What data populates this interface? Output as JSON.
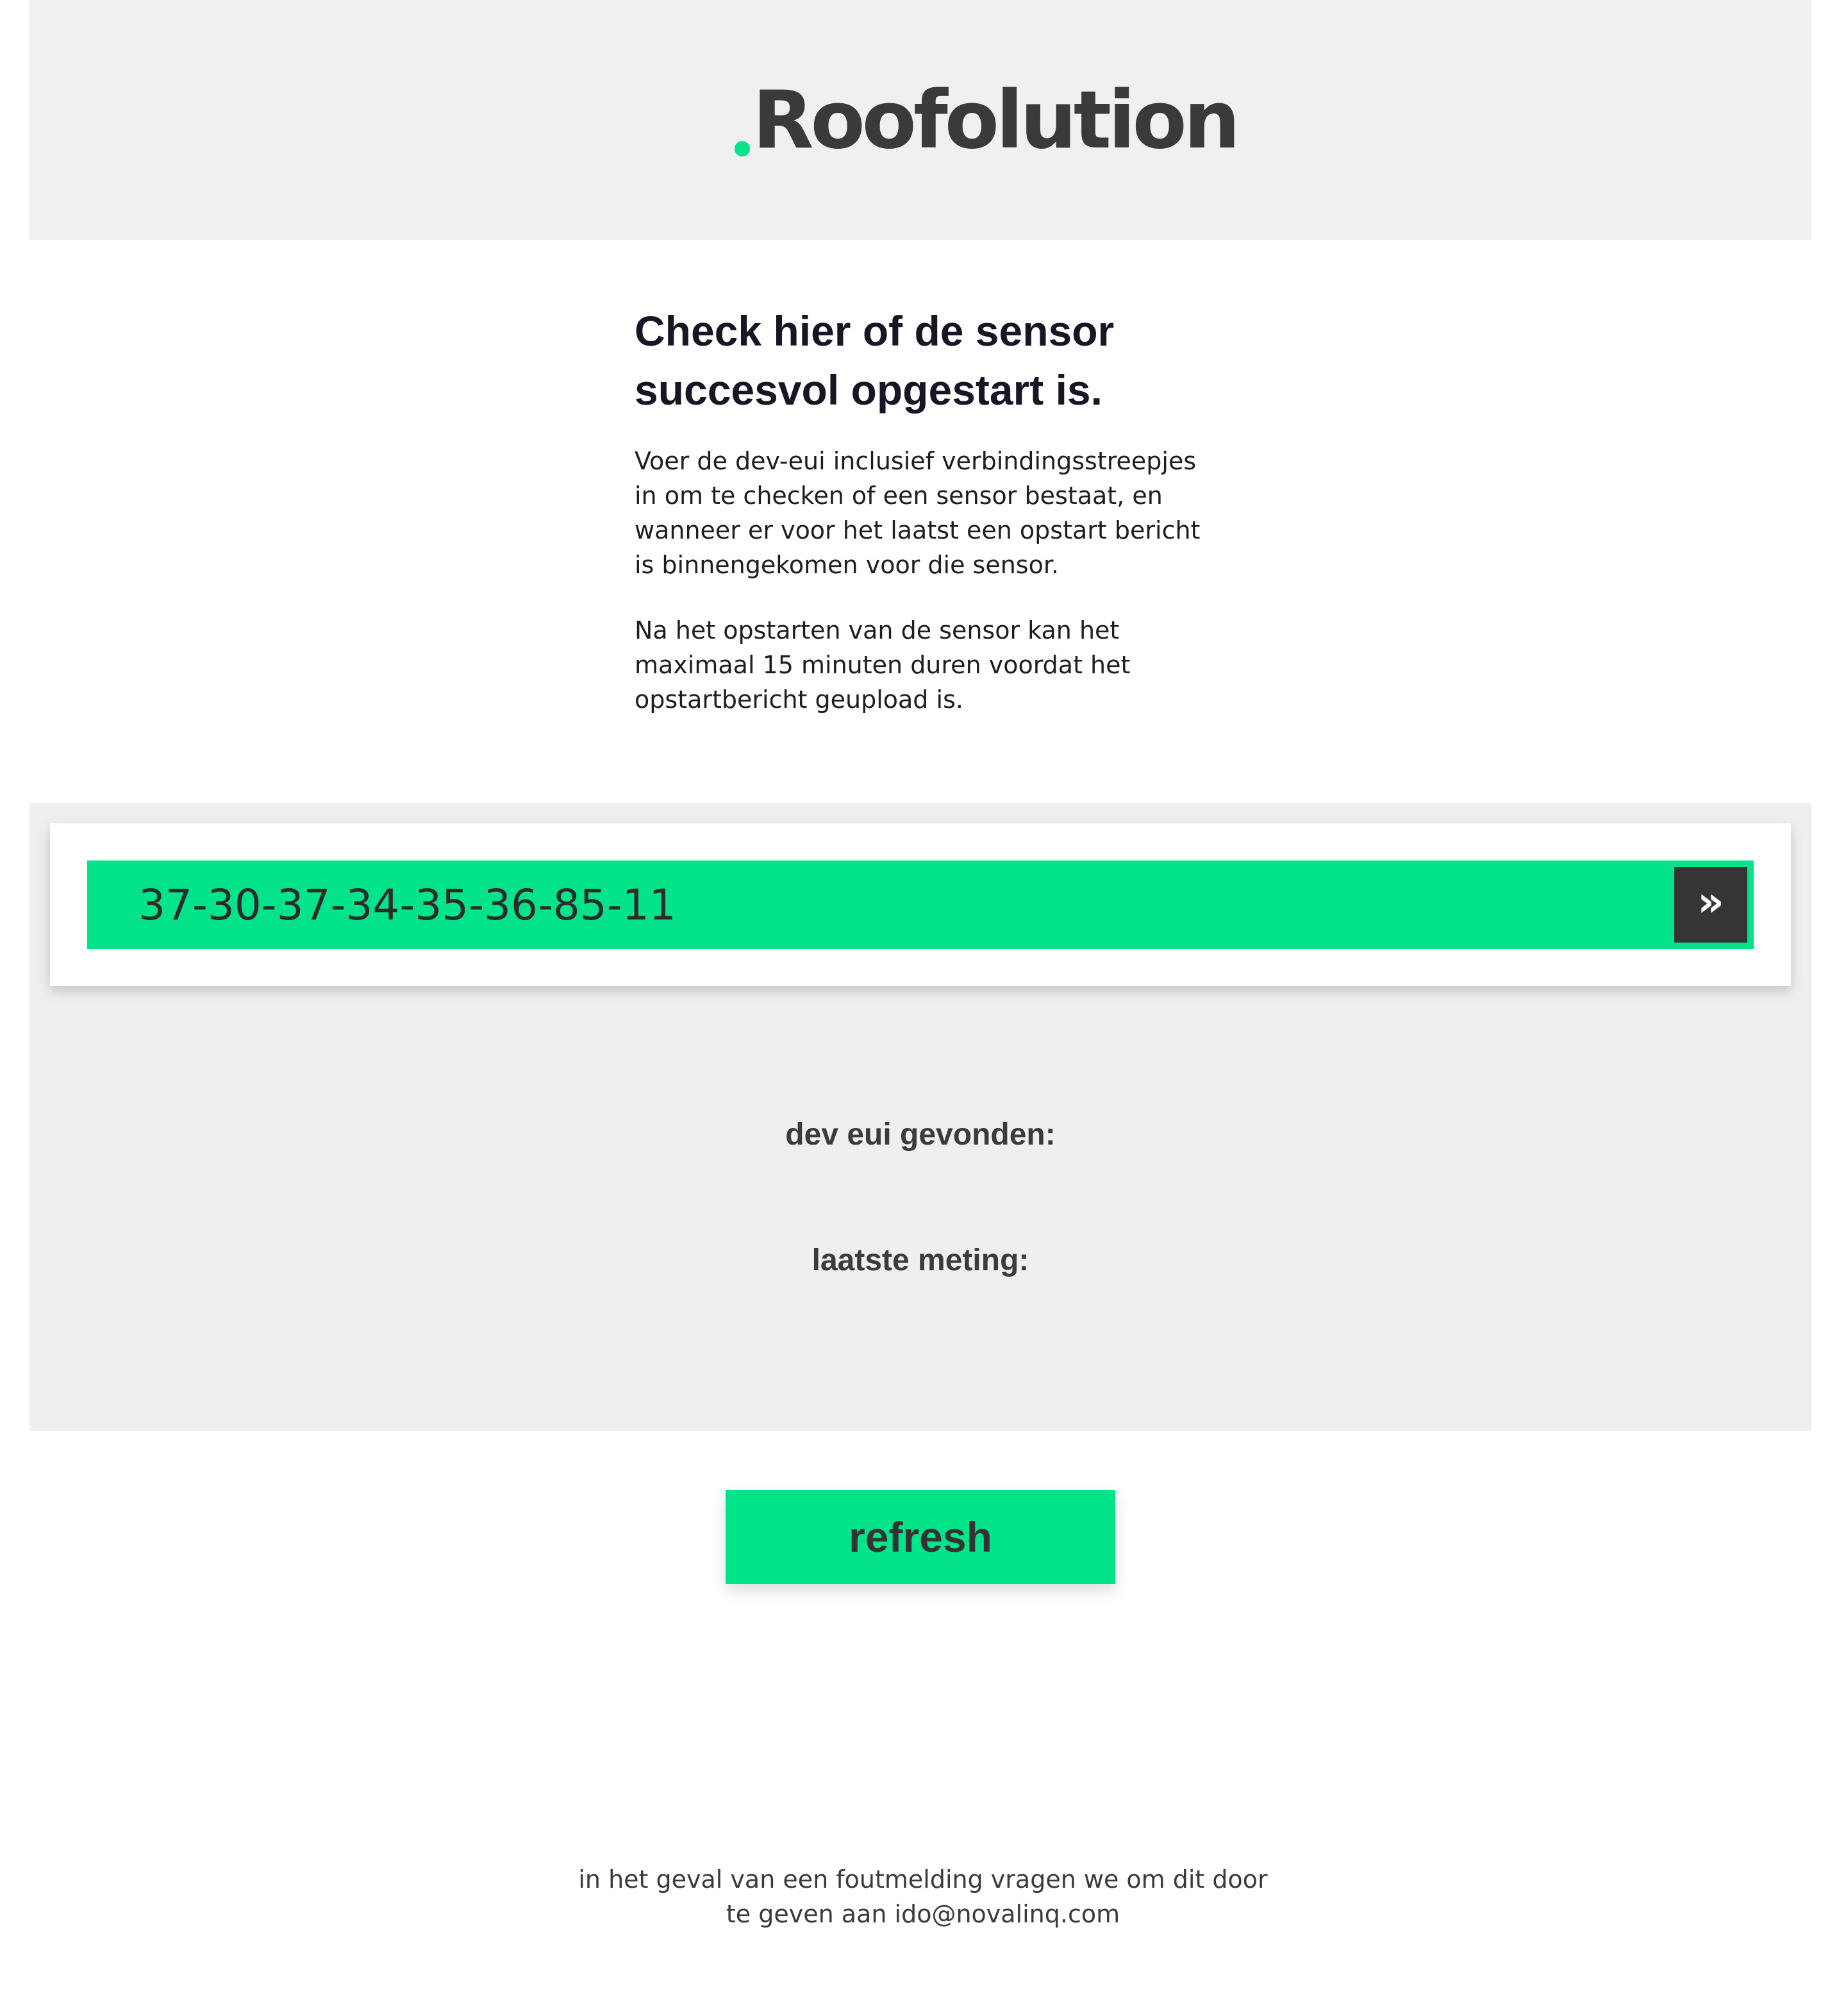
{
  "brand": {
    "name": "Roofolution",
    "accent_color": "#03e48a",
    "dark_color": "#3a3a3a"
  },
  "intro": {
    "title_line1": "Check hier of de sensor",
    "title_line2": "succesvol opgestart is.",
    "paragraph1": "Voer de dev-eui inclusief verbindingsstreepjes in om te checken of een sensor bestaat, en wanneer er voor het laatst een opstart bericht is binnengekomen voor die sensor.",
    "paragraph2": "Na het opstarten van de sensor kan het maximaal 15 minuten duren voordat het opstartbericht geupload is."
  },
  "search": {
    "value": "37-30-37-34-35-36-85-11",
    "submit_icon": "double-chevron-right-icon",
    "submit_glyph": "»"
  },
  "results": {
    "found_label": "dev eui gevonden:",
    "last_measurement_label": "laatste meting:"
  },
  "actions": {
    "refresh_label": "refresh"
  },
  "footer": {
    "line1": "in het geval van een foutmelding vragen we om dit door",
    "line2": "te geven aan ido@novalinq.com"
  }
}
